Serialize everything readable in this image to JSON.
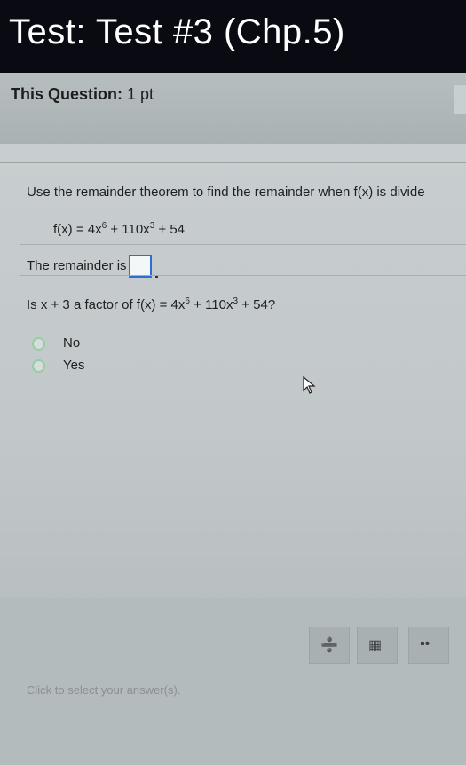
{
  "window": {
    "title": "Test: Test #3 (Chp.5)"
  },
  "question_bar": {
    "label": "This Question:",
    "points": "1 pt"
  },
  "question": {
    "prompt": "Use the remainder theorem to find the remainder when f(x) is divide",
    "function": {
      "lhs": "f(x) = 4x",
      "exp1": "6",
      "mid": " + 110x",
      "exp2": "3",
      "tail": " + 54"
    },
    "remainder_label": "The remainder is",
    "factor_question": {
      "pre": "Is x + 3 a factor of f(x) = 4x",
      "exp1": "6",
      "mid": " + 110x",
      "exp2": "3",
      "tail": " + 54?"
    },
    "options": [
      {
        "label": "No"
      },
      {
        "label": "Yes"
      }
    ]
  },
  "footer": {
    "hint": "Click to select your answer(s)."
  },
  "icons": [
    "fraction-icon",
    "mixed-number-icon",
    "exponent-icon",
    "mouse-cursor-icon",
    "radio-icon"
  ]
}
